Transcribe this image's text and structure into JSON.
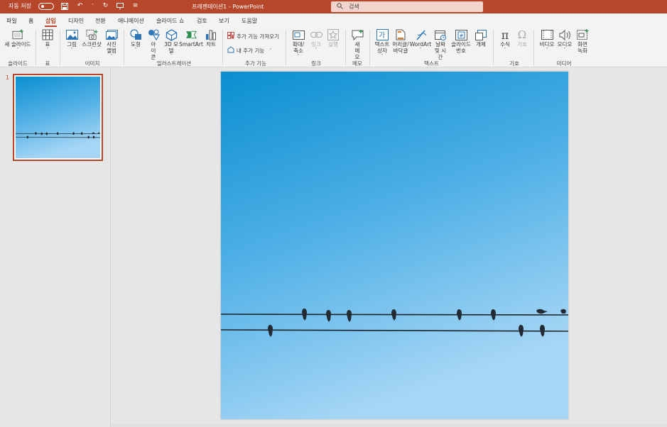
{
  "titlebar": {
    "autosave_label": "자동 저장",
    "autosave_state": "끔",
    "doc_title": "프레젠테이션1 - PowerPoint",
    "search_placeholder": "검색"
  },
  "tabs": [
    "파일",
    "홈",
    "삽입",
    "디자인",
    "전환",
    "애니메이션",
    "슬라이드 쇼",
    "검토",
    "보기",
    "도움말"
  ],
  "active_tab": "삽입",
  "ribbon": {
    "groups": {
      "slides": "슬라이드",
      "tables": "표",
      "images": "이미지",
      "illustrations": "일러스트레이션",
      "addins": "추가 기능",
      "links": "링크",
      "comments": "메모",
      "text": "텍스트",
      "symbols": "기호",
      "media": "미디어"
    },
    "buttons": {
      "new_slide": "새 슬라이드",
      "table": "표",
      "pictures": "그림",
      "screenshot": "스크린샷",
      "photo_album": "사진 앨범",
      "shapes": "도형",
      "icons": "아이콘",
      "model3d": "3D 모델",
      "smartart": "SmartArt",
      "chart": "차트",
      "get_addins": "추가 기능 가져오기",
      "my_addins": "내 추가 기능",
      "zoom": "확대/축소",
      "link": "링크",
      "action": "실행",
      "new_comment": "새 메모",
      "textbox": "텍스트 상자",
      "header_footer": "머리글/바닥글",
      "wordart": "WordArt",
      "date_time": "날짜 및 시간",
      "slide_number": "슬라이드 번호",
      "object": "개체",
      "equation": "수식",
      "symbol": "기호",
      "video": "비디오",
      "audio": "오디오",
      "screen_recording": "화면 녹화"
    }
  },
  "thumbnail": {
    "slide_number": "1"
  },
  "colors": {
    "accent": "#b7472a",
    "sky_top": "#0a8fd0",
    "sky_bottom": "#a6d6f5",
    "bird": "#222b33"
  },
  "icons": [
    "save-icon",
    "undo-icon",
    "redo-icon",
    "present-icon",
    "customize-icon",
    "search-icon"
  ]
}
